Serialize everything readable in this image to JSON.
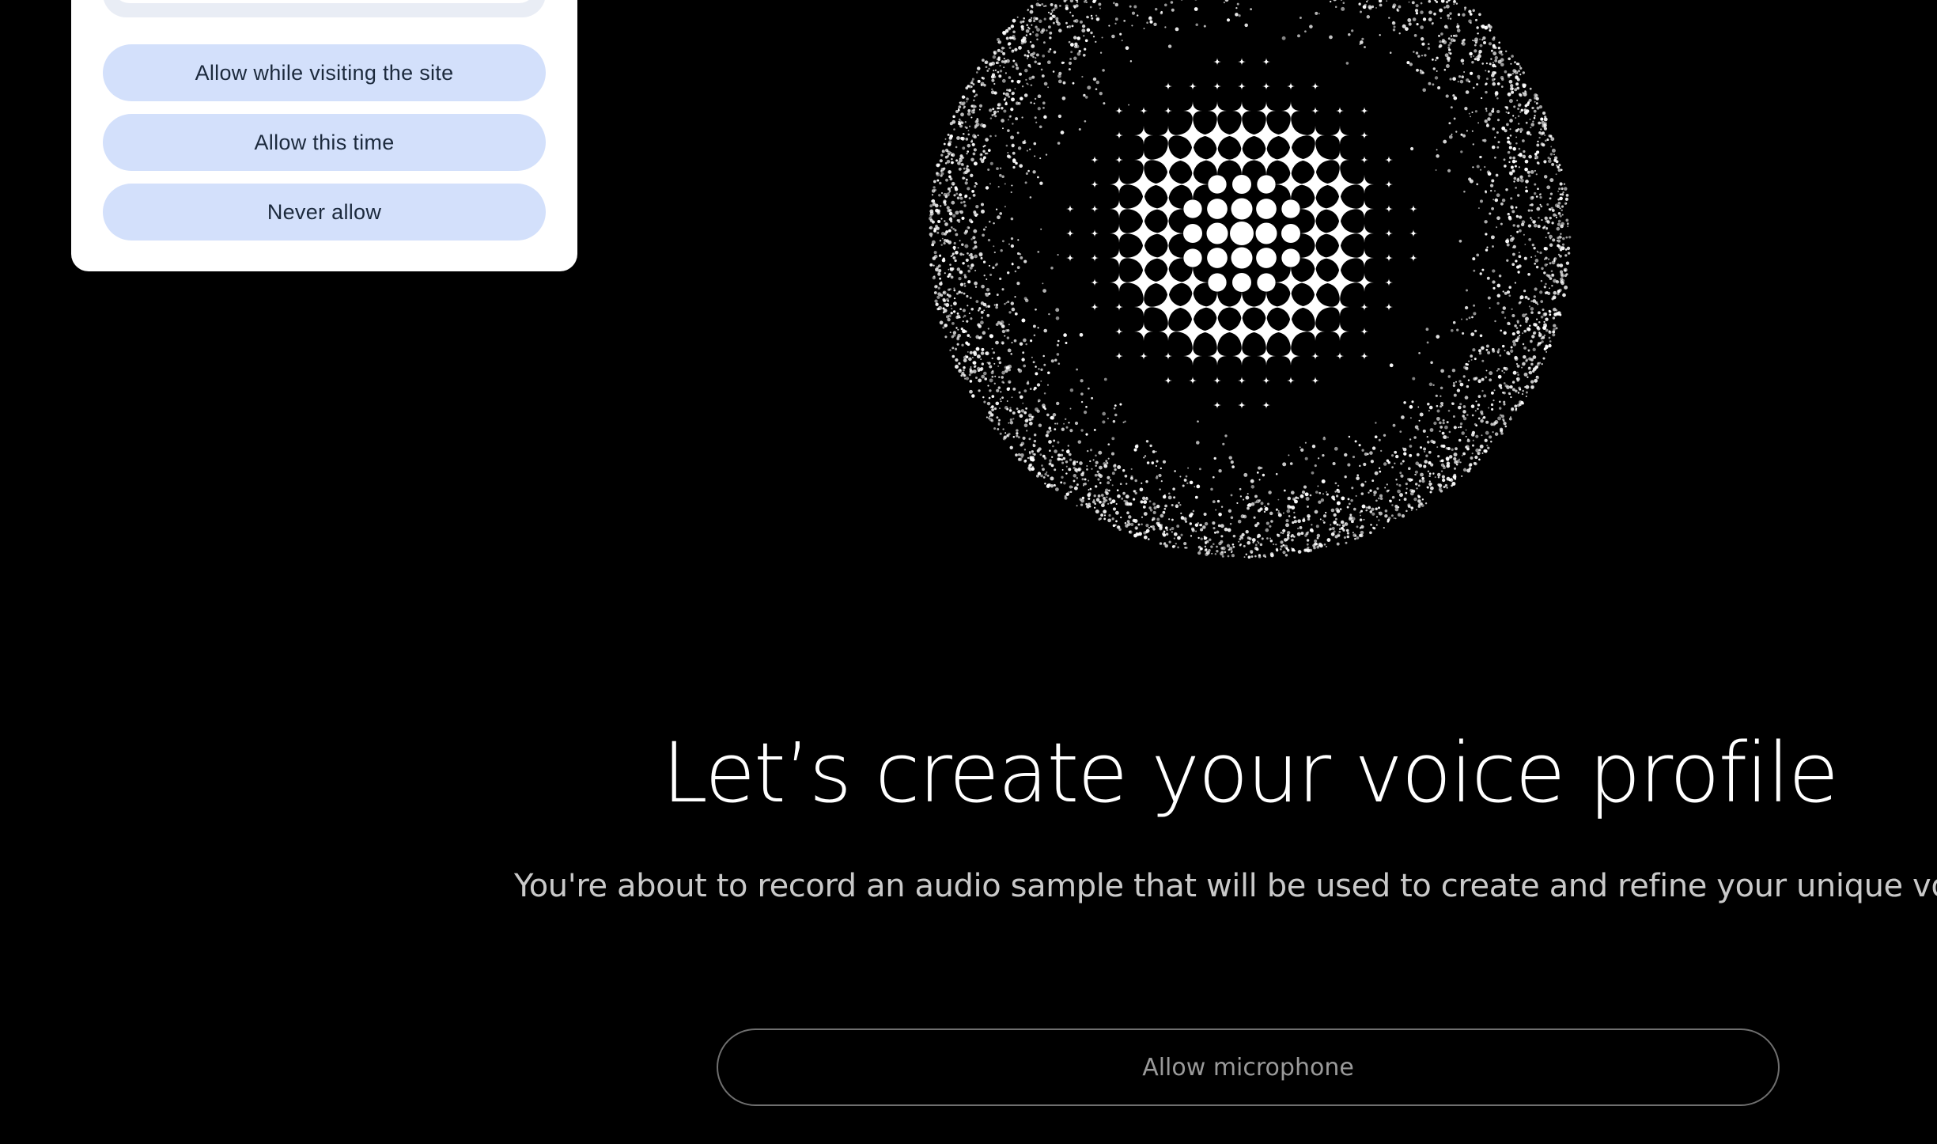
{
  "permission_popup": {
    "buttons": [
      {
        "label": "Allow while visiting the site"
      },
      {
        "label": "Allow this time"
      },
      {
        "label": "Never allow"
      }
    ]
  },
  "main": {
    "title": "Let’s create your voice profile",
    "subtitle": "You're about to record an audio sample that will be used to create and refine your unique voice prof",
    "mic_button_label": "Allow microphone"
  },
  "colors": {
    "background": "#000000",
    "popup_button_bg": "#d3e0fb",
    "popup_bg": "#ffffff",
    "sphere_particles": "#ffffff"
  }
}
